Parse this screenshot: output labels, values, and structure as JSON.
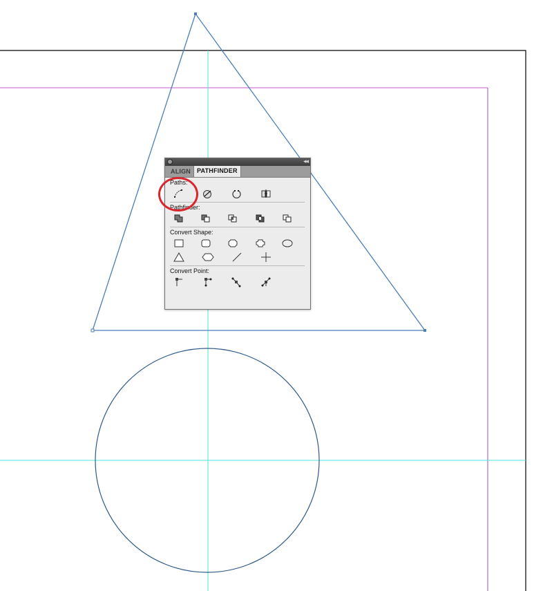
{
  "panel": {
    "tabs": [
      {
        "label": "ALIGN",
        "active": false
      },
      {
        "label": "PATHFINDER",
        "active": true
      }
    ],
    "collapse_glyph": "◂◂",
    "sections": {
      "paths": {
        "label": "Paths:",
        "icons": [
          "join-path-icon",
          "close-path-icon",
          "open-path-icon",
          "reverse-path-icon"
        ]
      },
      "pathfinder": {
        "label": "Pathfinder:",
        "icons": [
          "add-icon",
          "subtract-icon",
          "intersect-icon",
          "exclude-overlap-icon",
          "minus-back-icon"
        ]
      },
      "convert_shape": {
        "label": "Convert Shape:",
        "icons_row1": [
          "rectangle-icon",
          "rounded-rectangle-icon",
          "beveled-rectangle-icon",
          "inverse-rounded-rectangle-icon",
          "ellipse-icon"
        ],
        "icons_row2": [
          "triangle-icon",
          "polygon-icon",
          "line-icon",
          "orthogonal-line-icon"
        ]
      },
      "convert_point": {
        "label": "Convert Point:",
        "icons": [
          "plain-point-icon",
          "corner-point-icon",
          "smooth-point-icon",
          "symmetrical-point-icon"
        ]
      }
    }
  },
  "colors": {
    "shape_stroke": "#4a7fb8",
    "circle_stroke": "#2e5a8a",
    "guide_cyan": "#4ee0e0",
    "margin_magenta": "#cc55cc",
    "margin_purple": "#8855cc",
    "page_border": "#000000",
    "highlight_red": "#d9262c"
  }
}
